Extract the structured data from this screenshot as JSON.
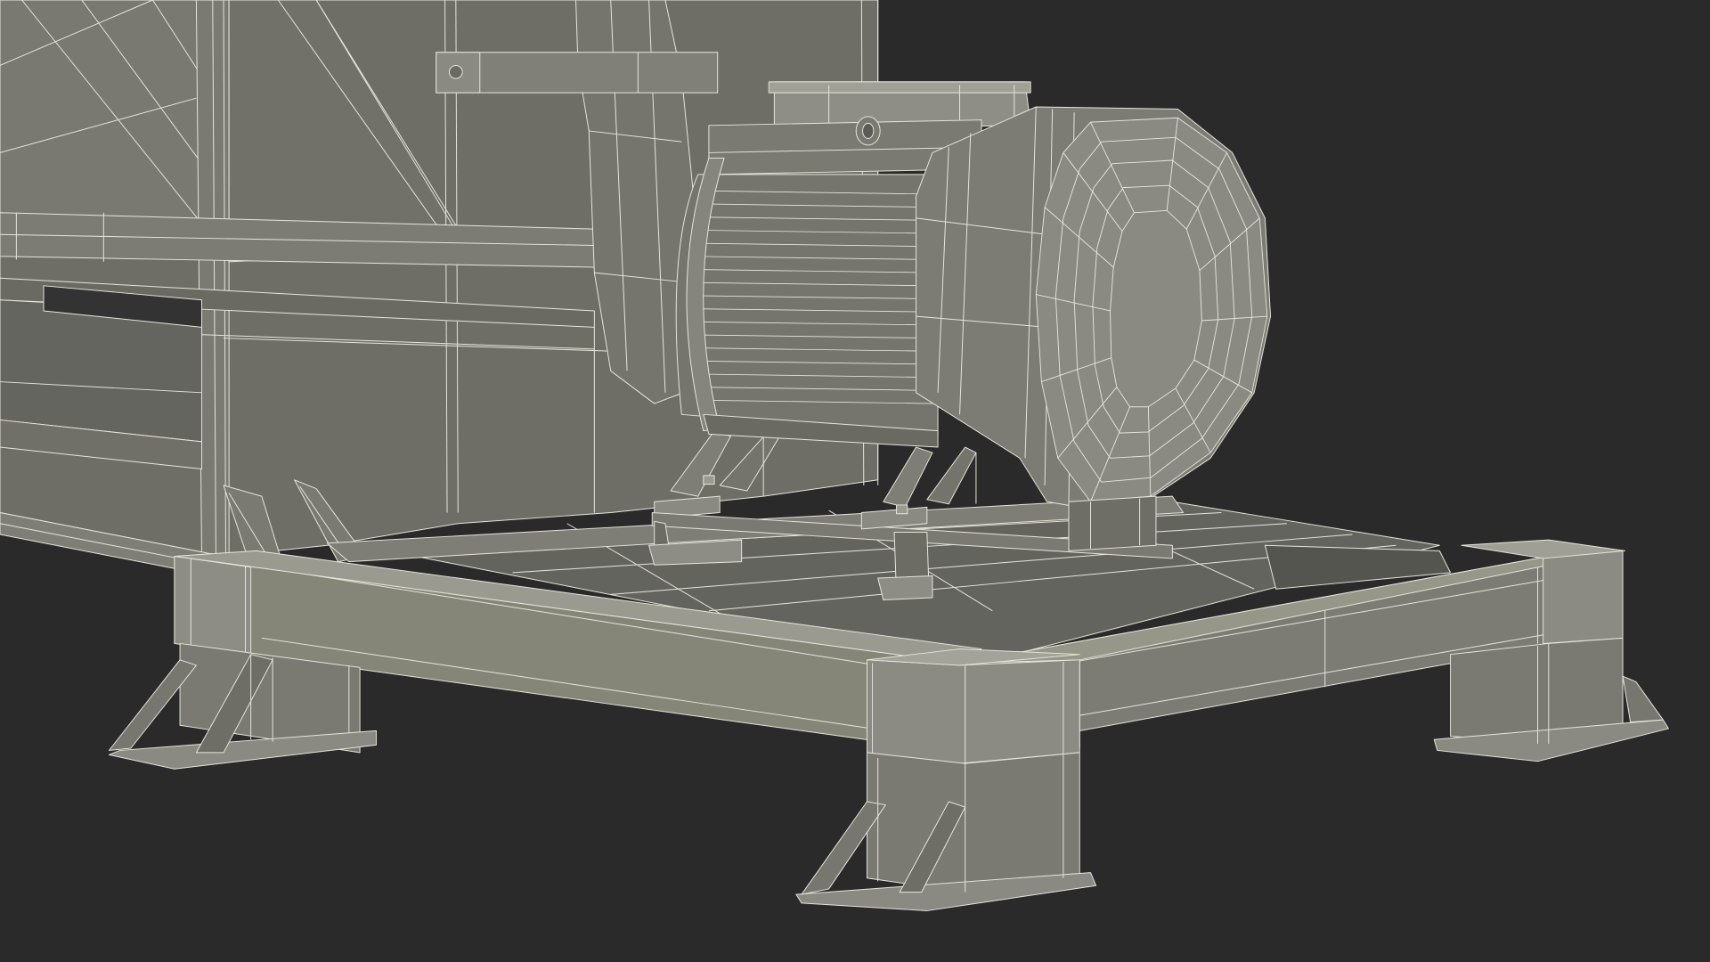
{
  "scene": {
    "subject": "wireframe-render-of-motor-on-steel-base-frame",
    "colors": {
      "background": "#2a2a2a",
      "surface": "#74746c",
      "surface_light": "#8a8a82",
      "surface_dark": "#5a5a53",
      "shadow": "#4a4a44",
      "wire": "#e6e6dc"
    }
  }
}
